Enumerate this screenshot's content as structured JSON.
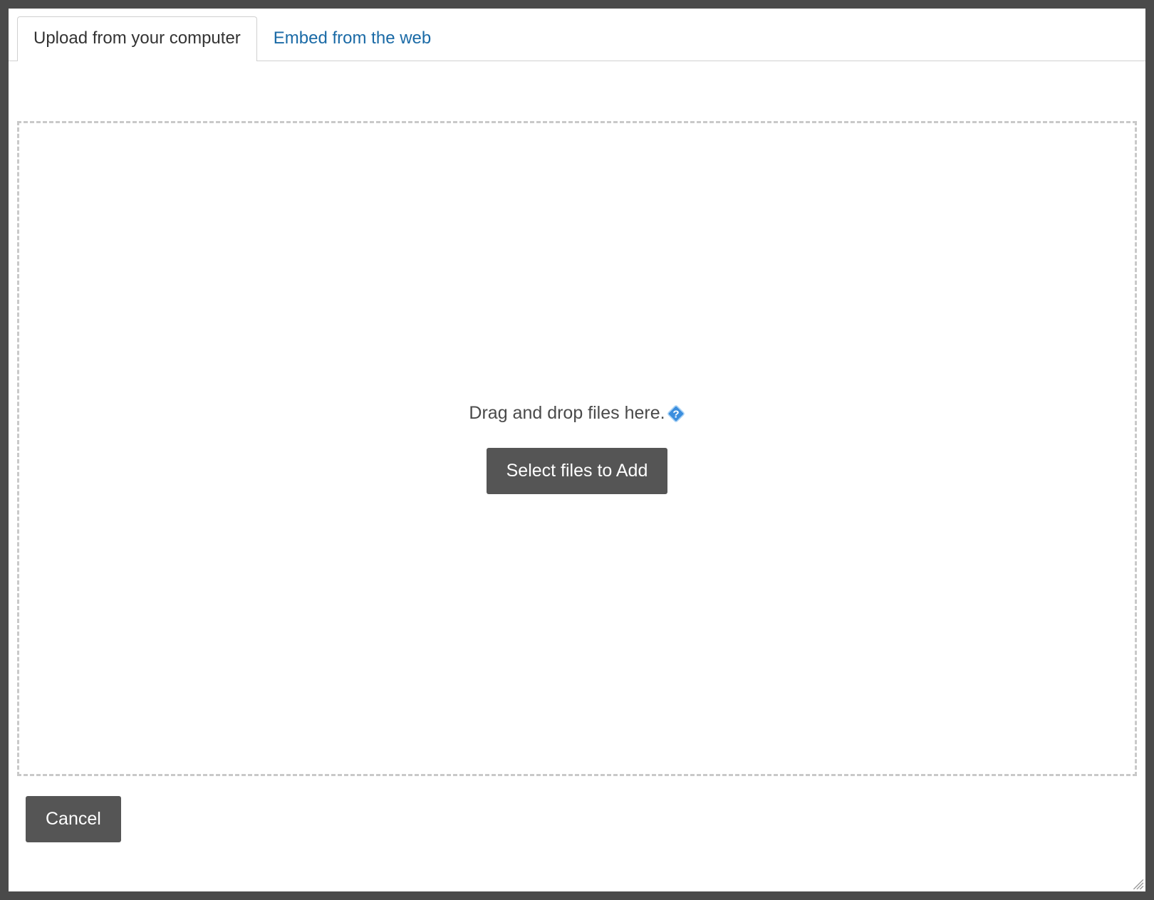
{
  "tabs": {
    "upload": {
      "label": "Upload from your computer",
      "active": true
    },
    "embed": {
      "label": "Embed from the web",
      "active": false
    }
  },
  "dropzone": {
    "instruction": "Drag and drop files here.",
    "select_button_label": "Select files to Add",
    "help_icon": "help-icon"
  },
  "footer": {
    "cancel_label": "Cancel"
  }
}
